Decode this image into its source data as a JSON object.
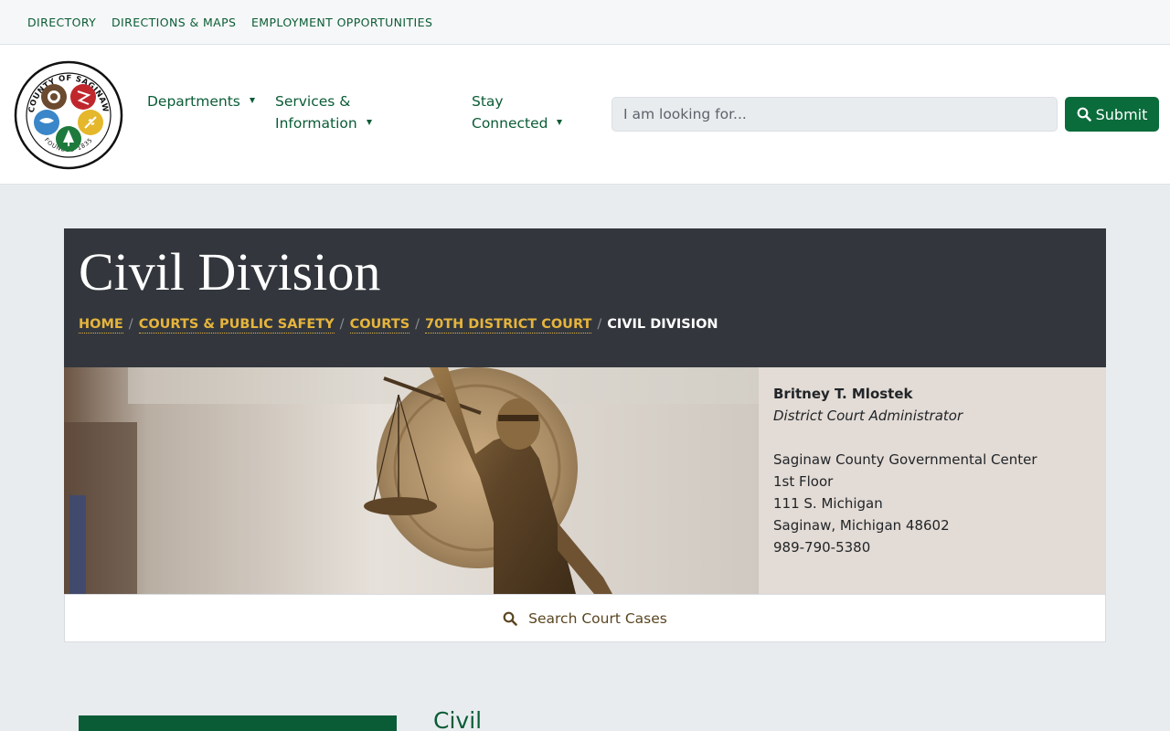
{
  "topbar": {
    "links": [
      {
        "label": "DIRECTORY"
      },
      {
        "label": "DIRECTIONS & MAPS"
      },
      {
        "label": "EMPLOYMENT OPPORTUNITIES"
      }
    ]
  },
  "logo": {
    "text_top": "COUNTY OF SAGINAW",
    "text_bottom": "FOUNDED 1835"
  },
  "nav": {
    "items": [
      {
        "line1": "Departments",
        "line2": ""
      },
      {
        "line1": "Services &",
        "line2": "Information"
      },
      {
        "line1": "Stay",
        "line2": "Connected"
      }
    ]
  },
  "search": {
    "placeholder": "I am looking for...",
    "submit_label": "Submit"
  },
  "page": {
    "title": "Civil Division",
    "breadcrumb": [
      "HOME",
      "COURTS & PUBLIC SAFETY",
      "COURTS",
      "70TH DISTRICT COURT"
    ],
    "breadcrumb_current": "CIVIL DIVISION"
  },
  "contact": {
    "name": "Britney T. Mlostek",
    "role": "District Court Administrator",
    "address": [
      "Saginaw County Governmental Center",
      "1st Floor",
      "111 S. Michigan",
      "Saginaw, Michigan 48602",
      "989-790-5380"
    ]
  },
  "court_search": {
    "label": "Search Court Cases"
  },
  "content": {
    "heading": "Civil"
  },
  "colors": {
    "brand_green": "#0a5c36",
    "header_dark": "#33373d",
    "breadcrumb_gold": "#e6b43d",
    "contact_bg": "#e3dbd5"
  }
}
